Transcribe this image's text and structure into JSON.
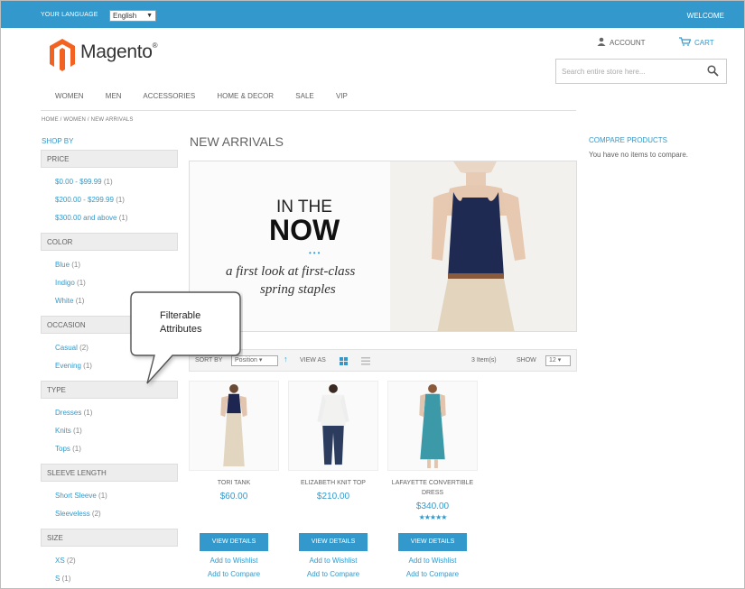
{
  "header": {
    "language_label": "YOUR LANGUAGE",
    "language_value": "English",
    "welcome": "WELCOME",
    "account": "ACCOUNT",
    "cart": "CART",
    "logo_text": "Magento",
    "logo_mark": "®",
    "search_placeholder": "Search entire store here..."
  },
  "nav": [
    "WOMEN",
    "MEN",
    "ACCESSORIES",
    "HOME & DECOR",
    "SALE",
    "VIP"
  ],
  "breadcrumb": "HOME  /  WOMEN  /  NEW ARRIVALS",
  "sidebar": {
    "title": "SHOP BY",
    "sections": [
      {
        "title": "PRICE",
        "items": [
          [
            "$0.00 - $99.99",
            "(1)"
          ],
          [
            "$200.00 - $299.99",
            "(1)"
          ],
          [
            "$300.00 and above",
            "(1)"
          ]
        ]
      },
      {
        "title": "COLOR",
        "items": [
          [
            "Blue",
            "(1)"
          ],
          [
            "Indigo",
            "(1)"
          ],
          [
            "White",
            "(1)"
          ]
        ]
      },
      {
        "title": "OCCASION",
        "items": [
          [
            "Casual",
            "(2)"
          ],
          [
            "Evening",
            "(1)"
          ]
        ]
      },
      {
        "title": "TYPE",
        "items": [
          [
            "Dresses",
            "(1)"
          ],
          [
            "Knits",
            "(1)"
          ],
          [
            "Tops",
            "(1)"
          ]
        ]
      },
      {
        "title": "SLEEVE LENGTH",
        "items": [
          [
            "Short Sleeve",
            "(1)"
          ],
          [
            "Sleeveless",
            "(2)"
          ]
        ]
      },
      {
        "title": "SIZE",
        "items": [
          [
            "XS",
            "(2)"
          ],
          [
            "S",
            "(1)"
          ]
        ]
      }
    ]
  },
  "main": {
    "title": "NEW ARRIVALS",
    "banner": {
      "line1": "IN THE",
      "line2": "NOW",
      "dots": "•••",
      "tag1": "a first look at first-class",
      "tag2": "spring staples"
    },
    "toolbar": {
      "sort_by": "SORT BY",
      "sort_value": "Position",
      "view_as": "VIEW AS",
      "items": "3 Item(s)",
      "show": "SHOW",
      "show_value": "12"
    },
    "products": [
      {
        "name": "TORI TANK",
        "price": "$60.00",
        "stars": "",
        "button": "VIEW DETAILS",
        "wishlist": "Add to Wishlist",
        "compare": "Add to Compare"
      },
      {
        "name": "ELIZABETH KNIT TOP",
        "price": "$210.00",
        "stars": "",
        "button": "VIEW DETAILS",
        "wishlist": "Add to Wishlist",
        "compare": "Add to Compare"
      },
      {
        "name": "LAFAYETTE CONVERTIBLE DRESS",
        "price": "$340.00",
        "stars": "★★★★★",
        "button": "VIEW DETAILS",
        "wishlist": "Add to Wishlist",
        "compare": "Add to Compare"
      }
    ]
  },
  "compare": {
    "title": "COMPARE PRODUCTS",
    "text": "You have no items to compare."
  },
  "callout": {
    "line1": "Filterable",
    "line2": "Attributes"
  },
  "colors": {
    "accent": "#3399cc",
    "logo": "#f26322"
  }
}
